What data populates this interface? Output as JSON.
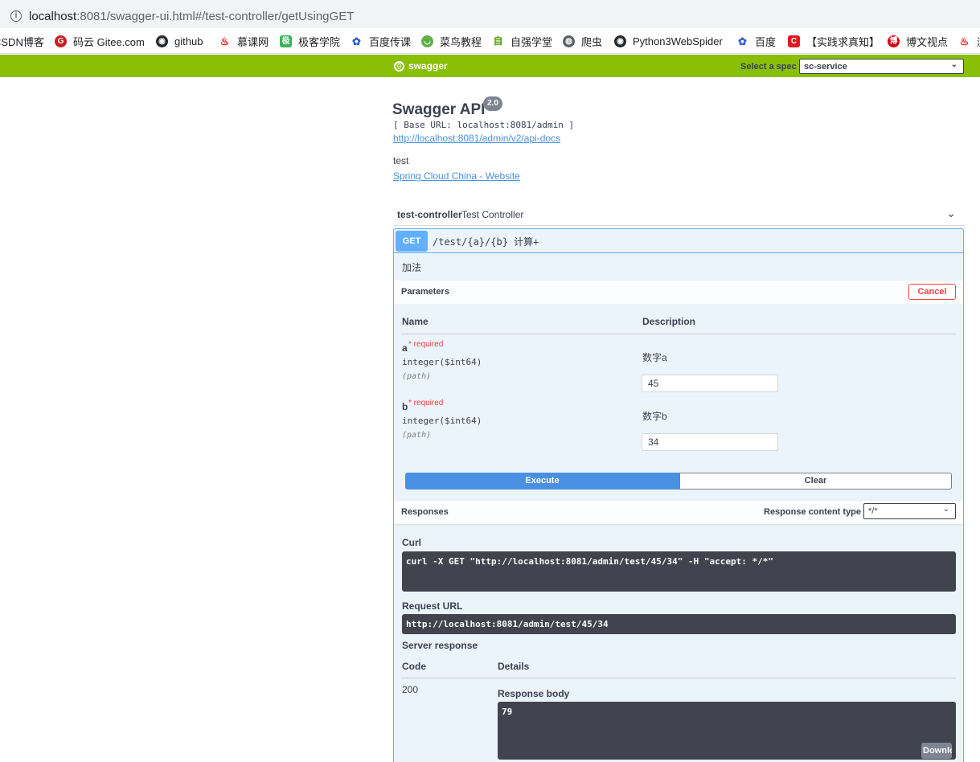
{
  "browser": {
    "url_host": "localhost",
    "url_rest": ":8081/swagger-ui.html#/test-controller/getUsingGET",
    "bookmarks": [
      {
        "label": "CSDN博客",
        "icon": "csdn-icon",
        "color": "#c32136"
      },
      {
        "label": "码云 Gitee.com",
        "icon": "gitee-icon",
        "color": "#c71d23"
      },
      {
        "label": "github",
        "icon": "github-icon",
        "color": "#24292e"
      },
      {
        "label": "慕课网",
        "icon": "imooc-icon",
        "color": "#f01414"
      },
      {
        "label": "极客学院",
        "icon": "jikexueyuan-icon",
        "color": "#35b558"
      },
      {
        "label": "百度传课",
        "icon": "baidu-paw-icon",
        "color": "#2e5fcc"
      },
      {
        "label": "菜鸟教程",
        "icon": "runoob-icon",
        "color": "#5db246"
      },
      {
        "label": "自强学堂",
        "icon": "ziqiang-icon",
        "color": "#4e9a06"
      },
      {
        "label": "爬虫",
        "icon": "globe-icon",
        "color": "#5f6368"
      },
      {
        "label": "Python3WebSpider",
        "icon": "github-icon",
        "color": "#24292e"
      },
      {
        "label": "百度",
        "icon": "baidu-paw-icon",
        "color": "#2e5fcc"
      },
      {
        "label": "【实践求真知】",
        "icon": "c-logo-icon",
        "color": "#e0191e"
      },
      {
        "label": "博文视点",
        "icon": "bowen-icon",
        "color": "#d7000f"
      },
      {
        "label": "浏",
        "icon": "flame-icon",
        "color": "#f01414"
      }
    ]
  },
  "topbar": {
    "logo_text": "swagger",
    "spec_label": "Select a spec",
    "spec_value": "sc-service"
  },
  "info": {
    "title": "Swagger API",
    "version": "2.0",
    "base_url": "[ Base URL: localhost:8081/admin ]",
    "docs_link": "http://localhost:8081/admin/v2/api-docs",
    "description": "test",
    "website_link": "Spring Cloud China - Website"
  },
  "tag": {
    "name": "test-controller",
    "description": "Test Controller"
  },
  "operation": {
    "method": "GET",
    "path": "/test/{a}/{b} 计算+",
    "description": "加法",
    "parameters_title": "Parameters",
    "cancel_label": "Cancel",
    "col_name": "Name",
    "col_description": "Description",
    "params": [
      {
        "name": "a",
        "required": "required",
        "type": "integer($int64)",
        "in": "(path)",
        "description": "数字a",
        "value": "45"
      },
      {
        "name": "b",
        "required": "required",
        "type": "integer($int64)",
        "in": "(path)",
        "description": "数字b",
        "value": "34"
      }
    ],
    "execute_label": "Execute",
    "clear_label": "Clear"
  },
  "responses": {
    "title": "Responses",
    "content_type_label": "Response content type",
    "content_type_value": "*/*",
    "curl_label": "Curl",
    "curl": "curl -X GET \"http://localhost:8081/admin/test/45/34\" -H \"accept: */*\"",
    "request_url_label": "Request URL",
    "request_url": "http://localhost:8081/admin/test/45/34",
    "server_response_label": "Server response",
    "col_code": "Code",
    "col_details": "Details",
    "code": "200",
    "body_label": "Response body",
    "body": "79",
    "download_label": "Download"
  }
}
